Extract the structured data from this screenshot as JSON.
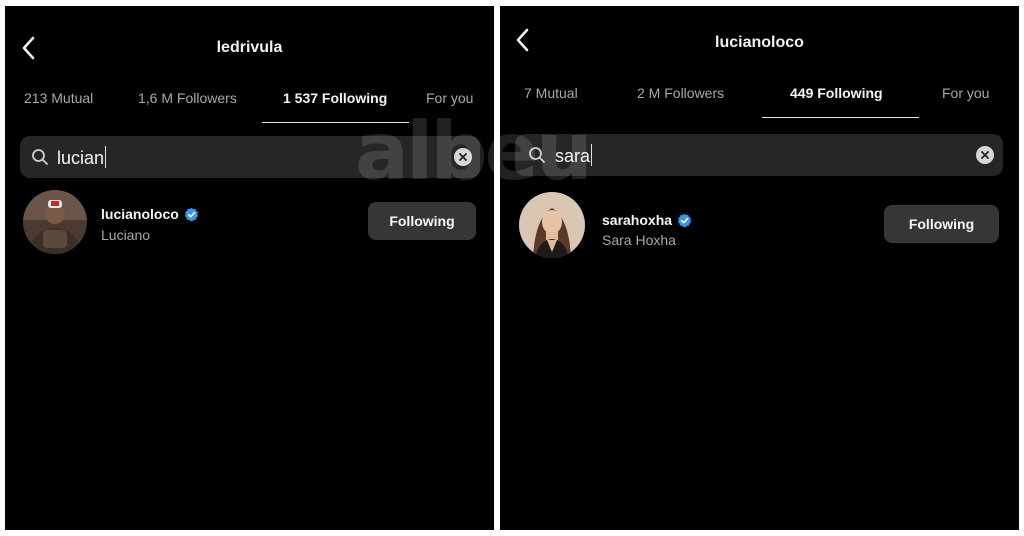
{
  "left_panel": {
    "title": "ledrivula",
    "tabs": [
      {
        "label": "213 Mutual"
      },
      {
        "label": "1,6 M Followers"
      },
      {
        "label": "1 537 Following"
      },
      {
        "label": "For you"
      }
    ],
    "active_tab": 2,
    "search": {
      "query": "lucian"
    },
    "result": {
      "username": "lucianoloco",
      "full_name": "Luciano",
      "verified": true,
      "button_label": "Following"
    }
  },
  "right_panel": {
    "title": "lucianoloco",
    "tabs": [
      {
        "label": "7 Mutual"
      },
      {
        "label": "2 M Followers"
      },
      {
        "label": "449 Following"
      },
      {
        "label": "For you"
      }
    ],
    "active_tab": 2,
    "search": {
      "query": "sara"
    },
    "result": {
      "username": "sarahoxha",
      "full_name": "Sara Hoxha",
      "verified": true,
      "button_label": "Following"
    }
  },
  "watermark": {
    "text": "albeu"
  },
  "colors": {
    "background": "#000000",
    "search_bg": "#262626",
    "button_bg": "#363636",
    "verified_blue": "#3797f0",
    "muted_text": "#a8a8a8"
  },
  "icons": [
    "back-chevron-icon",
    "search-icon",
    "clear-icon",
    "verified-badge-icon"
  ]
}
